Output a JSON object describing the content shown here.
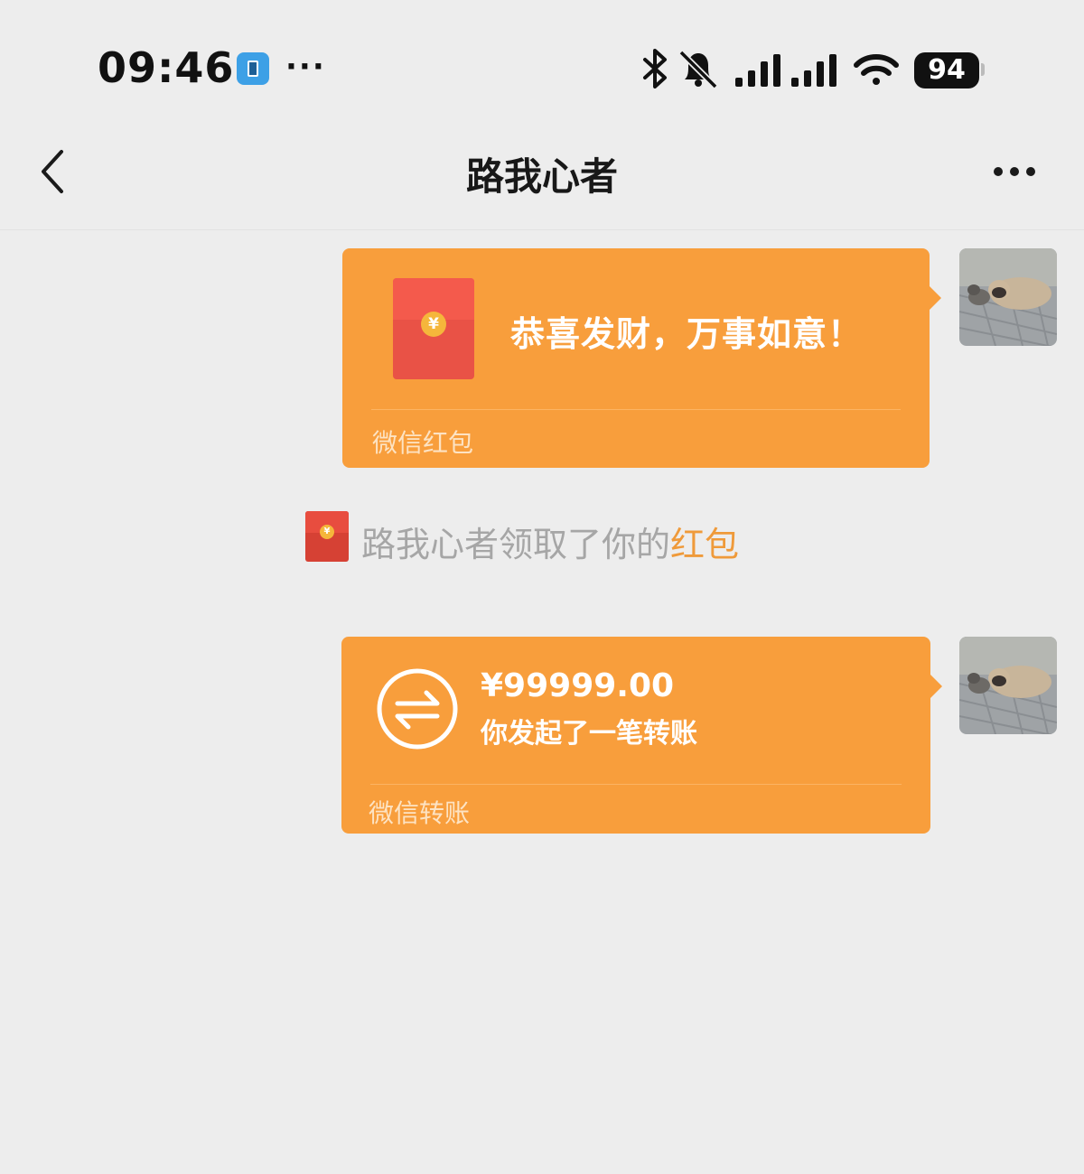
{
  "status_bar": {
    "time": "09:46",
    "app_icon": "mobile-app-icon",
    "more": "···",
    "icons": [
      "bluetooth-icon",
      "mute-bell-icon",
      "signal-icon",
      "wifi-icon"
    ],
    "battery": "94"
  },
  "nav": {
    "back_icon": "chevron-left-icon",
    "title": "路我心者",
    "more_icon": "more-dots-icon"
  },
  "messages": {
    "red_packet": {
      "greeting": "恭喜发财，万事如意！",
      "coin": "¥",
      "footer": "微信红包"
    },
    "system": {
      "text": "路我心者领取了你的",
      "link": "红包",
      "coin": "¥"
    },
    "transfer": {
      "amount": "¥99999.00",
      "description": "你发起了一笔转账",
      "footer": "微信转账",
      "icon": "transfer-arrows-icon"
    }
  },
  "colors": {
    "background": "#ededed",
    "bubble": "#f89e3c",
    "red_envelope": "#e95246",
    "link_orange": "#ef9a3a"
  }
}
